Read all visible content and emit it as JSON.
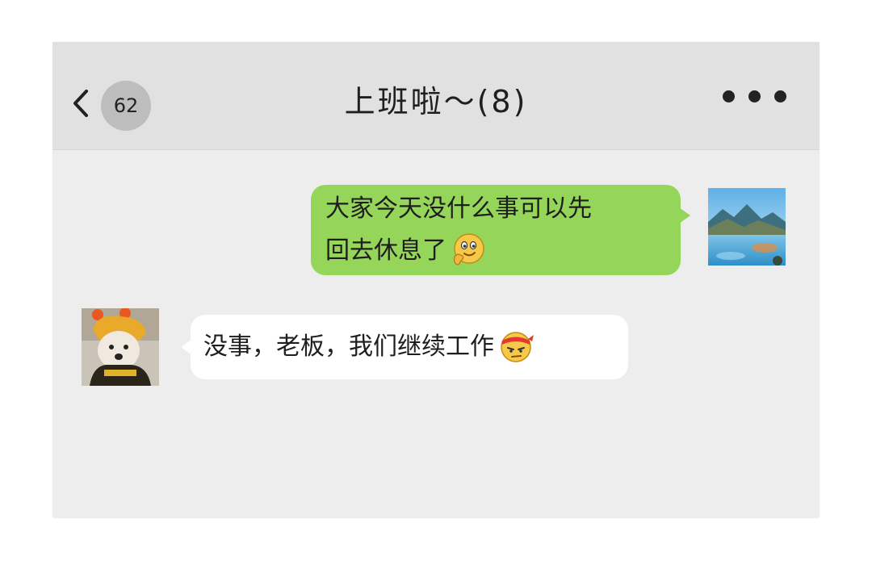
{
  "header": {
    "back_icon": "chevron-left-icon",
    "unread_count": "62",
    "title": "上班啦～(8)",
    "more_icon": "more-dots-icon"
  },
  "messages": [
    {
      "sender": "self",
      "lines": [
        "大家今天没什么事可以先",
        "回去休息了"
      ],
      "emoji": "thinking-emoji-icon",
      "bubble_color": "#95d65a"
    },
    {
      "sender": "other",
      "lines": [
        "没事，老板，我们继续工作"
      ],
      "emoji": "headband-emoji-icon",
      "bubble_color": "#ffffff"
    }
  ],
  "colors": {
    "chat_background": "#ededed",
    "header_background": "#e1e1e1",
    "self_bubble": "#95d65a",
    "other_bubble": "#ffffff",
    "badge": "#bdbdbd"
  }
}
